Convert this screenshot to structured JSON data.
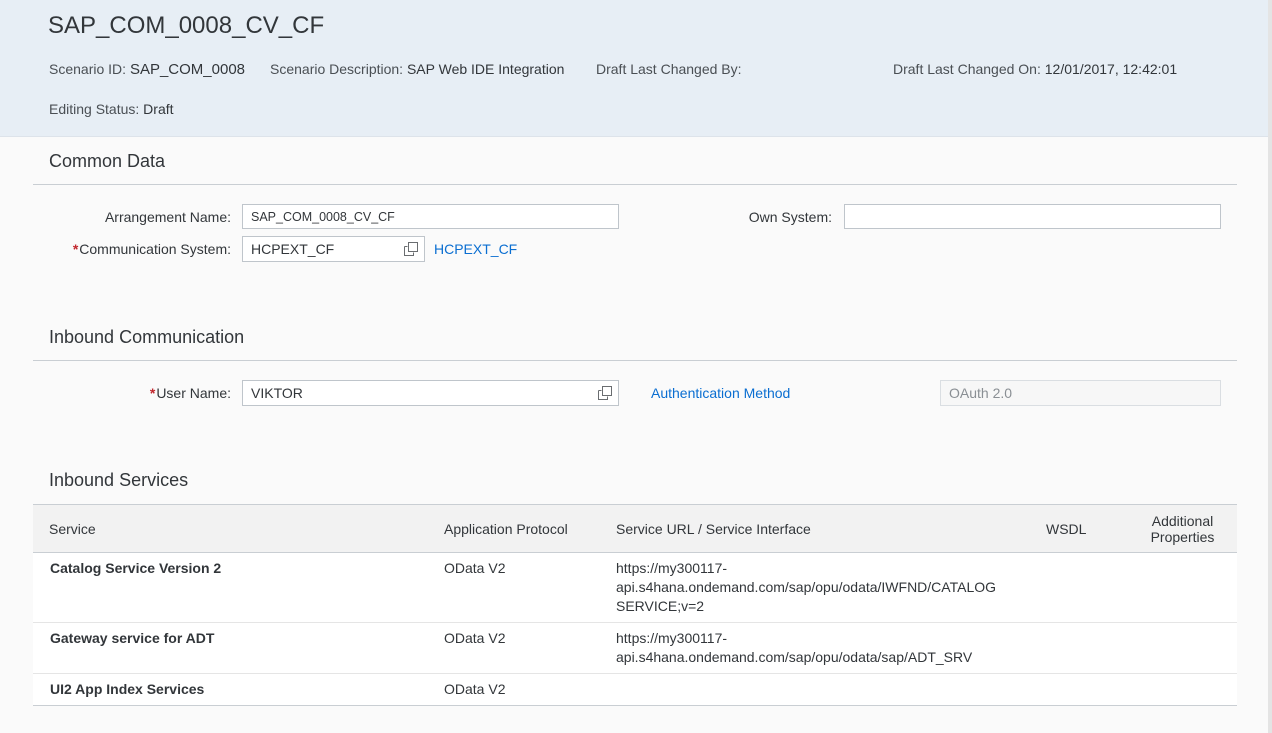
{
  "header": {
    "title": "SAP_COM_0008_CV_CF",
    "scenario_id_label": "Scenario ID:",
    "scenario_id_value": "SAP_COM_0008",
    "scenario_desc_label": "Scenario Description:",
    "scenario_desc_value": "SAP Web IDE Integration",
    "draft_changed_by_label": "Draft Last Changed By:",
    "draft_changed_by_value": "",
    "draft_changed_on_label": "Draft Last Changed On:",
    "draft_changed_on_value": "12/01/2017, 12:42:01",
    "editing_status_label": "Editing Status:",
    "editing_status_value": "Draft"
  },
  "common_data": {
    "title": "Common Data",
    "arrangement_name_label": "Arrangement Name:",
    "arrangement_name_value": "SAP_COM_0008_CV_CF",
    "own_system_label": "Own System:",
    "own_system_value": "",
    "comm_system_required": "*",
    "comm_system_label": "Communication System:",
    "comm_system_value": "HCPEXT_CF",
    "comm_system_link": "HCPEXT_CF"
  },
  "inbound_communication": {
    "title": "Inbound Communication",
    "user_name_required": "*",
    "user_name_label": "User Name:",
    "user_name_value": "VIKTOR",
    "auth_method_label": "Authentication Method",
    "auth_method_value": "OAuth 2.0"
  },
  "inbound_services": {
    "title": "Inbound Services",
    "columns": {
      "service": "Service",
      "protocol": "Application Protocol",
      "url": "Service URL / Service Interface",
      "wsdl": "WSDL",
      "additional_1": "Additional",
      "additional_2": "Properties"
    },
    "rows": [
      {
        "service": "Catalog Service Version 2",
        "protocol": "OData V2",
        "url_1": "https://my300117-",
        "url_2": "api.s4hana.ondemand.com/sap/opu/odata/IWFND/CATALOG",
        "url_3": "SERVICE;v=2"
      },
      {
        "service": "Gateway service for ADT",
        "protocol": "OData V2",
        "url_1": "https://my300117-",
        "url_2": "api.s4hana.ondemand.com/sap/opu/odata/sap/ADT_SRV",
        "url_3": ""
      },
      {
        "service": "UI2 App Index Services",
        "protocol": "OData V2",
        "url_1": "",
        "url_2": "",
        "url_3": ""
      }
    ]
  },
  "icons": {
    "value_help": "value-help-icon"
  }
}
